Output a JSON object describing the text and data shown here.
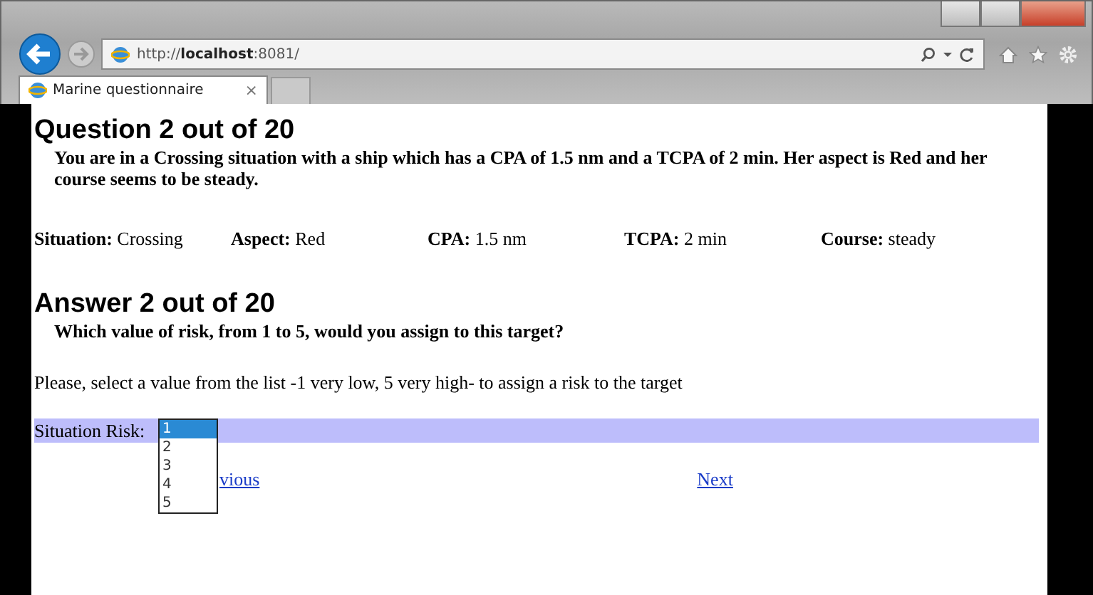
{
  "browser": {
    "address": "http://**localhost**:8081/",
    "tabs": [
      {
        "label": "Marine questionnaire",
        "close": "×",
        "selected": true
      }
    ]
  },
  "question": {
    "heading": "Question 2 out of 20",
    "text": "You are in a Crossing situation with a ship which has a CPA of 1.5 nm and a TCPA of 2 min. Her aspect is Red and her course seems to be steady.",
    "facts": [
      {
        "label": "Situation:",
        "value": "Crossing"
      },
      {
        "label": "Aspect:",
        "value": "Red"
      },
      {
        "label": "CPA:",
        "value": "1.5 nm"
      },
      {
        "label": "TCPA:",
        "value": "2 min"
      },
      {
        "label": "Course:",
        "value": "steady"
      }
    ]
  },
  "answer": {
    "heading": "Answer 2 out of 20",
    "text": "Which value of risk, from 1 to 5, would you assign to this target?",
    "instruction": "Please, select a value from the list -1 very low, 5 very high- to assign a risk to the target",
    "risk": {
      "label": "Situation Risk:",
      "options": [
        {
          "label": "1",
          "selected": true
        },
        {
          "label": "2",
          "selected": false
        },
        {
          "label": "3",
          "selected": false
        },
        {
          "label": "4",
          "selected": false
        },
        {
          "label": "5",
          "selected": false
        }
      ]
    }
  },
  "links": [
    {
      "label": "vious"
    },
    {
      "label": "Next"
    }
  ]
}
